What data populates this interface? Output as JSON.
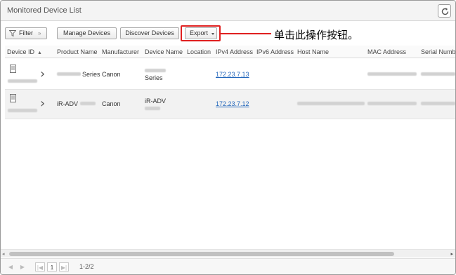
{
  "window": {
    "title": "Monitored Device List",
    "refresh_icon": "refresh-icon"
  },
  "toolbar": {
    "filter_label": "Filter",
    "filter_dropdown": "»",
    "manage_label": "Manage Devices",
    "discover_label": "Discover Devices",
    "export_label": "Export"
  },
  "annotation": {
    "callout_text": "单击此操作按钮。",
    "highlight_color": "#e02020"
  },
  "table": {
    "columns": [
      "Device ID",
      "Product Name",
      "Manufacturer",
      "Device Name",
      "Location",
      "IPv4 Address",
      "IPv6 Address",
      "Host Name",
      "MAC Address",
      "Serial Numbe"
    ],
    "sort_indicator": "▲",
    "rows": [
      {
        "product_name": "Series",
        "manufacturer": "Canon",
        "device_name": "Series",
        "ipv4": "172.23.7.13"
      },
      {
        "product_name": "iR-ADV",
        "manufacturer": "Canon",
        "device_name": "iR-ADV",
        "ipv4": "172.23.7.12"
      }
    ]
  },
  "pager": {
    "current_page": "1",
    "range": "1-2/2"
  },
  "colors": {
    "link": "#2266bb",
    "row_alt": "#f2f2f2"
  }
}
